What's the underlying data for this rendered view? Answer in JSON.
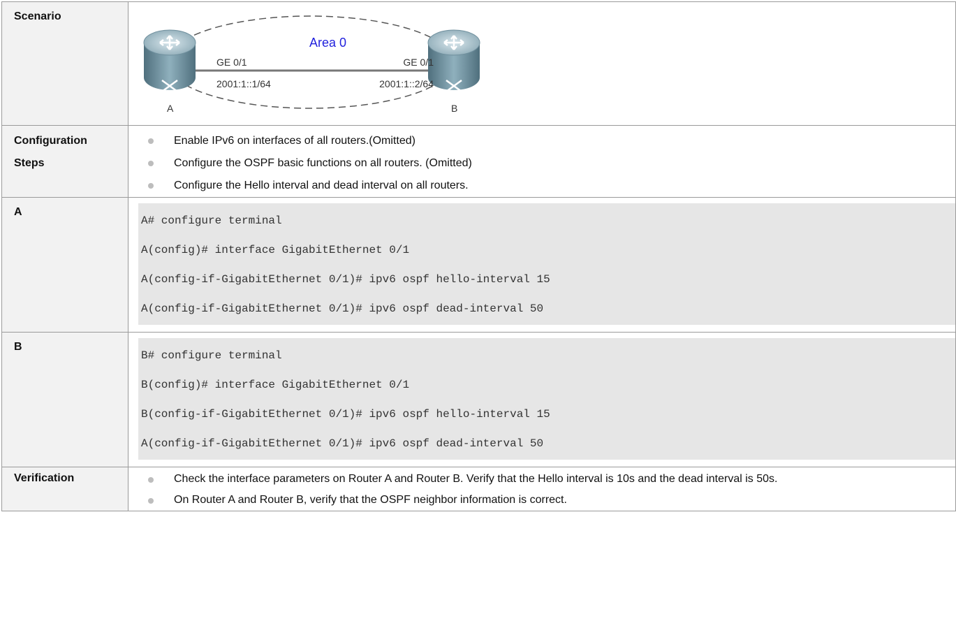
{
  "rows": {
    "scenario": {
      "label": "Scenario",
      "diagram": {
        "area_label": "Area 0",
        "router_a": {
          "name": "A",
          "interface": "GE 0/1",
          "address": "2001:1::1/64"
        },
        "router_b": {
          "name": "B",
          "interface": "GE 0/1",
          "address": "2001:1::2/64"
        },
        "colors": {
          "area_label": "#2222dd",
          "router_body": "#6f8f9d",
          "link": "#777777"
        }
      }
    },
    "config_steps": {
      "label_line1": "Configuration",
      "label_line2": "Steps",
      "items": [
        "Enable IPv6 on interfaces of all routers.(Omitted)",
        "Configure the OSPF basic functions on all routers. (Omitted)",
        "Configure the Hello interval and dead interval on all routers."
      ]
    },
    "router_a": {
      "label": "A",
      "code": [
        "A# configure terminal",
        "A(config)# interface GigabitEthernet 0/1",
        "A(config-if-GigabitEthernet 0/1)# ipv6 ospf hello-interval 15",
        "A(config-if-GigabitEthernet 0/1)# ipv6 ospf dead-interval 50"
      ]
    },
    "router_b": {
      "label": "B",
      "code": [
        "B# configure terminal",
        "B(config)# interface GigabitEthernet 0/1",
        "B(config-if-GigabitEthernet 0/1)# ipv6 ospf hello-interval 15",
        "A(config-if-GigabitEthernet 0/1)# ipv6 ospf dead-interval 50"
      ]
    },
    "verification": {
      "label": "Verification",
      "items": [
        "Check the interface parameters on Router A and Router B. Verify that the Hello interval is 10s and the dead interval is 50s.",
        "On Router A and Router B, verify that the OSPF neighbor information is correct."
      ]
    }
  }
}
